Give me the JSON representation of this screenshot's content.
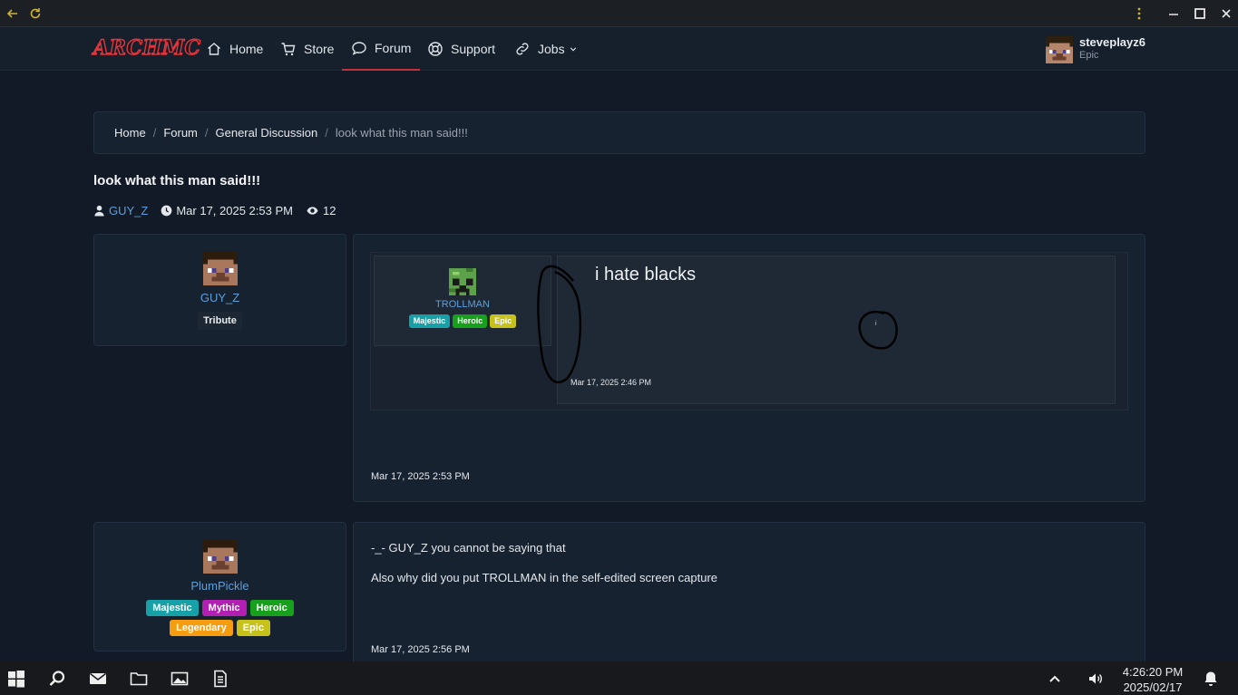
{
  "browser": {
    "back_icon": "arrow-left-icon",
    "reload_icon": "reload-icon",
    "menu_icon": "kebab-menu-icon",
    "minimize_icon": "minimize-icon",
    "maximize_icon": "maximize-icon",
    "close_icon": "close-icon"
  },
  "nav": {
    "logo": "ARCHMC",
    "items": [
      {
        "label": "Home",
        "icon": "home-icon"
      },
      {
        "label": "Store",
        "icon": "cart-icon"
      },
      {
        "label": "Forum",
        "icon": "chat-icon"
      },
      {
        "label": "Support",
        "icon": "lifebuoy-icon"
      },
      {
        "label": "Jobs",
        "icon": "link-icon"
      }
    ],
    "user": {
      "name": "steveplayz6",
      "rank": "Epic"
    }
  },
  "breadcrumb": [
    "Home",
    "Forum",
    "General Discussion",
    "look what this man said!!!"
  ],
  "thread": {
    "title": "look what this man said!!!",
    "author": "GUY_Z",
    "date": "Mar 17, 2025 2:53 PM",
    "views": "12"
  },
  "posts": [
    {
      "author": "GUY_Z",
      "badges": [
        "Tribute"
      ],
      "date": "Mar 17, 2025 2:53 PM",
      "embedded": {
        "author": "TROLLMAN",
        "badges": [
          "Majestic",
          "Heroic",
          "Epic"
        ],
        "text": "i hate blacks",
        "dot": "i",
        "date": "Mar 17, 2025 2:46 PM"
      }
    },
    {
      "author": "PlumPickle",
      "badges": [
        "Majestic",
        "Mythic",
        "Heroic",
        "Legendary",
        "Epic"
      ],
      "lines": [
        "-_- GUY_Z you cannot be saying that",
        "Also why did you put TROLLMAN in the self-edited screen capture"
      ],
      "date": "Mar 17, 2025 2:56 PM"
    }
  ],
  "taskbar": {
    "icons": [
      "windows-start-icon",
      "search-icon",
      "mail-icon",
      "folder-icon",
      "image-icon",
      "document-icon"
    ],
    "time": "4:26:20 PM",
    "date": "2025/02/17"
  },
  "colors": {
    "accent_red": "#c0303a",
    "link_blue": "#5f9fd8",
    "majestic": "#16a1a8",
    "mythic": "#b21fb3",
    "heroic": "#17a01c",
    "legendary": "#f59d0e",
    "epic": "#c7c21a"
  }
}
